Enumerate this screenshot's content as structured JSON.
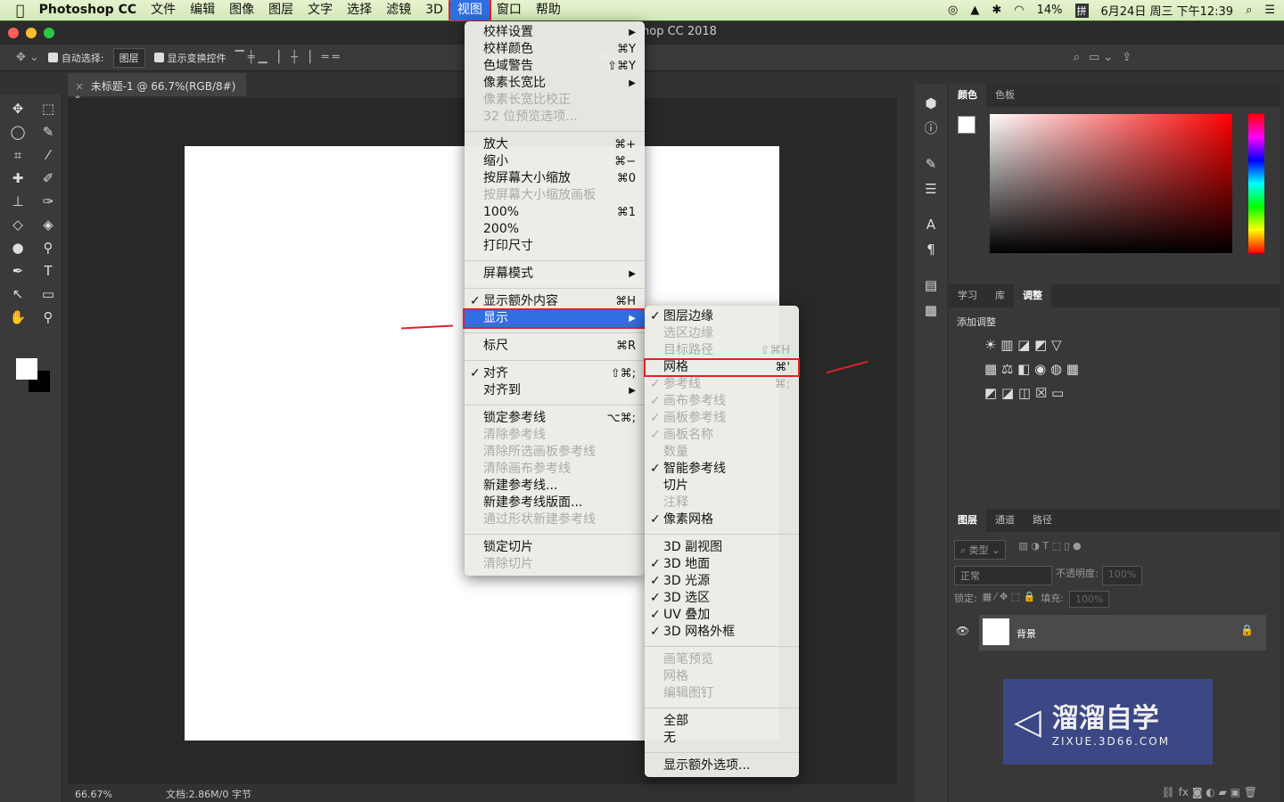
{
  "menubar": {
    "app": "Photoshop CC",
    "items": [
      "文件",
      "编辑",
      "图像",
      "图层",
      "文字",
      "选择",
      "滤镜",
      "3D",
      "视图",
      "窗口",
      "帮助"
    ],
    "active": "视图",
    "status": {
      "battery": "14%",
      "ime": "拼",
      "datetime": "6月24日 周三 下午12:39"
    }
  },
  "window": {
    "title": "hop CC 2018"
  },
  "options": {
    "auto_select_label": "自动选择:",
    "auto_select_value": "图层",
    "show_transform_label": "显示变换控件"
  },
  "document": {
    "tab": "未标题-1 @ 66.7%(RGB/8#) *",
    "zoom": "66.67%",
    "docinfo": "文档:2.86M/0 字节"
  },
  "view_menu": [
    {
      "label": "校样设置",
      "sub": true
    },
    {
      "label": "校样颜色",
      "sc": "⌘Y"
    },
    {
      "label": "色域警告",
      "sc": "⇧⌘Y"
    },
    {
      "label": "像素长宽比",
      "sub": true
    },
    {
      "label": "像素长宽比校正",
      "dis": true
    },
    {
      "label": "32 位预览选项...",
      "dis": true
    },
    {
      "sep": true
    },
    {
      "label": "放大",
      "sc": "⌘+"
    },
    {
      "label": "缩小",
      "sc": "⌘−"
    },
    {
      "label": "按屏幕大小缩放",
      "sc": "⌘0"
    },
    {
      "label": "按屏幕大小缩放画板",
      "dis": true
    },
    {
      "label": "100%",
      "sc": "⌘1"
    },
    {
      "label": "200%"
    },
    {
      "label": "打印尺寸"
    },
    {
      "sep": true
    },
    {
      "label": "屏幕模式",
      "sub": true
    },
    {
      "sep": true
    },
    {
      "label": "显示额外内容",
      "sc": "⌘H",
      "check": true
    },
    {
      "label": "显示",
      "sub": true,
      "hl": true
    },
    {
      "sep": true
    },
    {
      "label": "标尺",
      "sc": "⌘R"
    },
    {
      "sep": true
    },
    {
      "label": "对齐",
      "sc": "⇧⌘;",
      "check": true
    },
    {
      "label": "对齐到",
      "sub": true
    },
    {
      "sep": true
    },
    {
      "label": "锁定参考线",
      "sc": "⌥⌘;"
    },
    {
      "label": "清除参考线",
      "dis": true
    },
    {
      "label": "清除所选画板参考线",
      "dis": true
    },
    {
      "label": "清除画布参考线",
      "dis": true
    },
    {
      "label": "新建参考线..."
    },
    {
      "label": "新建参考线版面..."
    },
    {
      "label": "通过形状新建参考线",
      "dis": true
    },
    {
      "sep": true
    },
    {
      "label": "锁定切片"
    },
    {
      "label": "清除切片",
      "dis": true
    }
  ],
  "show_submenu": [
    {
      "label": "图层边缘",
      "check": true
    },
    {
      "label": "选区边缘",
      "dis": true
    },
    {
      "label": "目标路径",
      "sc": "⇧⌘H",
      "dis": true
    },
    {
      "label": "网格",
      "sc": "⌘'",
      "box": true
    },
    {
      "label": "参考线",
      "sc": "⌘;",
      "check": true,
      "dis": true
    },
    {
      "label": "画布参考线",
      "check": true,
      "dis": true
    },
    {
      "label": "画板参考线",
      "check": true,
      "dis": true
    },
    {
      "label": "画板名称",
      "check": true,
      "dis": true
    },
    {
      "label": "数量",
      "dis": true
    },
    {
      "label": "智能参考线",
      "check": true
    },
    {
      "label": "切片"
    },
    {
      "label": "注释",
      "dis": true
    },
    {
      "label": "像素网格",
      "check": true
    },
    {
      "sep": true
    },
    {
      "label": "3D 副视图"
    },
    {
      "label": "3D 地面",
      "check": true
    },
    {
      "label": "3D 光源",
      "check": true
    },
    {
      "label": "3D 选区",
      "check": true
    },
    {
      "label": "UV 叠加",
      "check": true
    },
    {
      "label": "3D 网格外框",
      "check": true
    },
    {
      "sep": true
    },
    {
      "label": "画笔预览",
      "dis": true
    },
    {
      "label": "网格",
      "dis": true
    },
    {
      "label": "编辑图钉",
      "dis": true
    },
    {
      "sep": true
    },
    {
      "label": "全部"
    },
    {
      "label": "无"
    },
    {
      "sep": true
    },
    {
      "label": "显示额外选项..."
    }
  ],
  "panels": {
    "color_tabs": [
      "颜色",
      "色板"
    ],
    "adjust_tabs": [
      "学习",
      "库",
      "调整"
    ],
    "adjust_title": "添加调整",
    "layer_tabs": [
      "图层",
      "通道",
      "路径"
    ],
    "filter_kind": "类型",
    "blend_mode": "正常",
    "opacity_label": "不透明度:",
    "opacity": "100%",
    "lock_label": "锁定:",
    "fill_label": "填充:",
    "fill": "100%",
    "layer_name": "背景"
  },
  "watermark": {
    "name": "溜溜自学",
    "url": "ZIXUE.3D66.COM"
  },
  "colors": {
    "highlight": "#2f6fe0",
    "annotation": "#e0202a"
  }
}
